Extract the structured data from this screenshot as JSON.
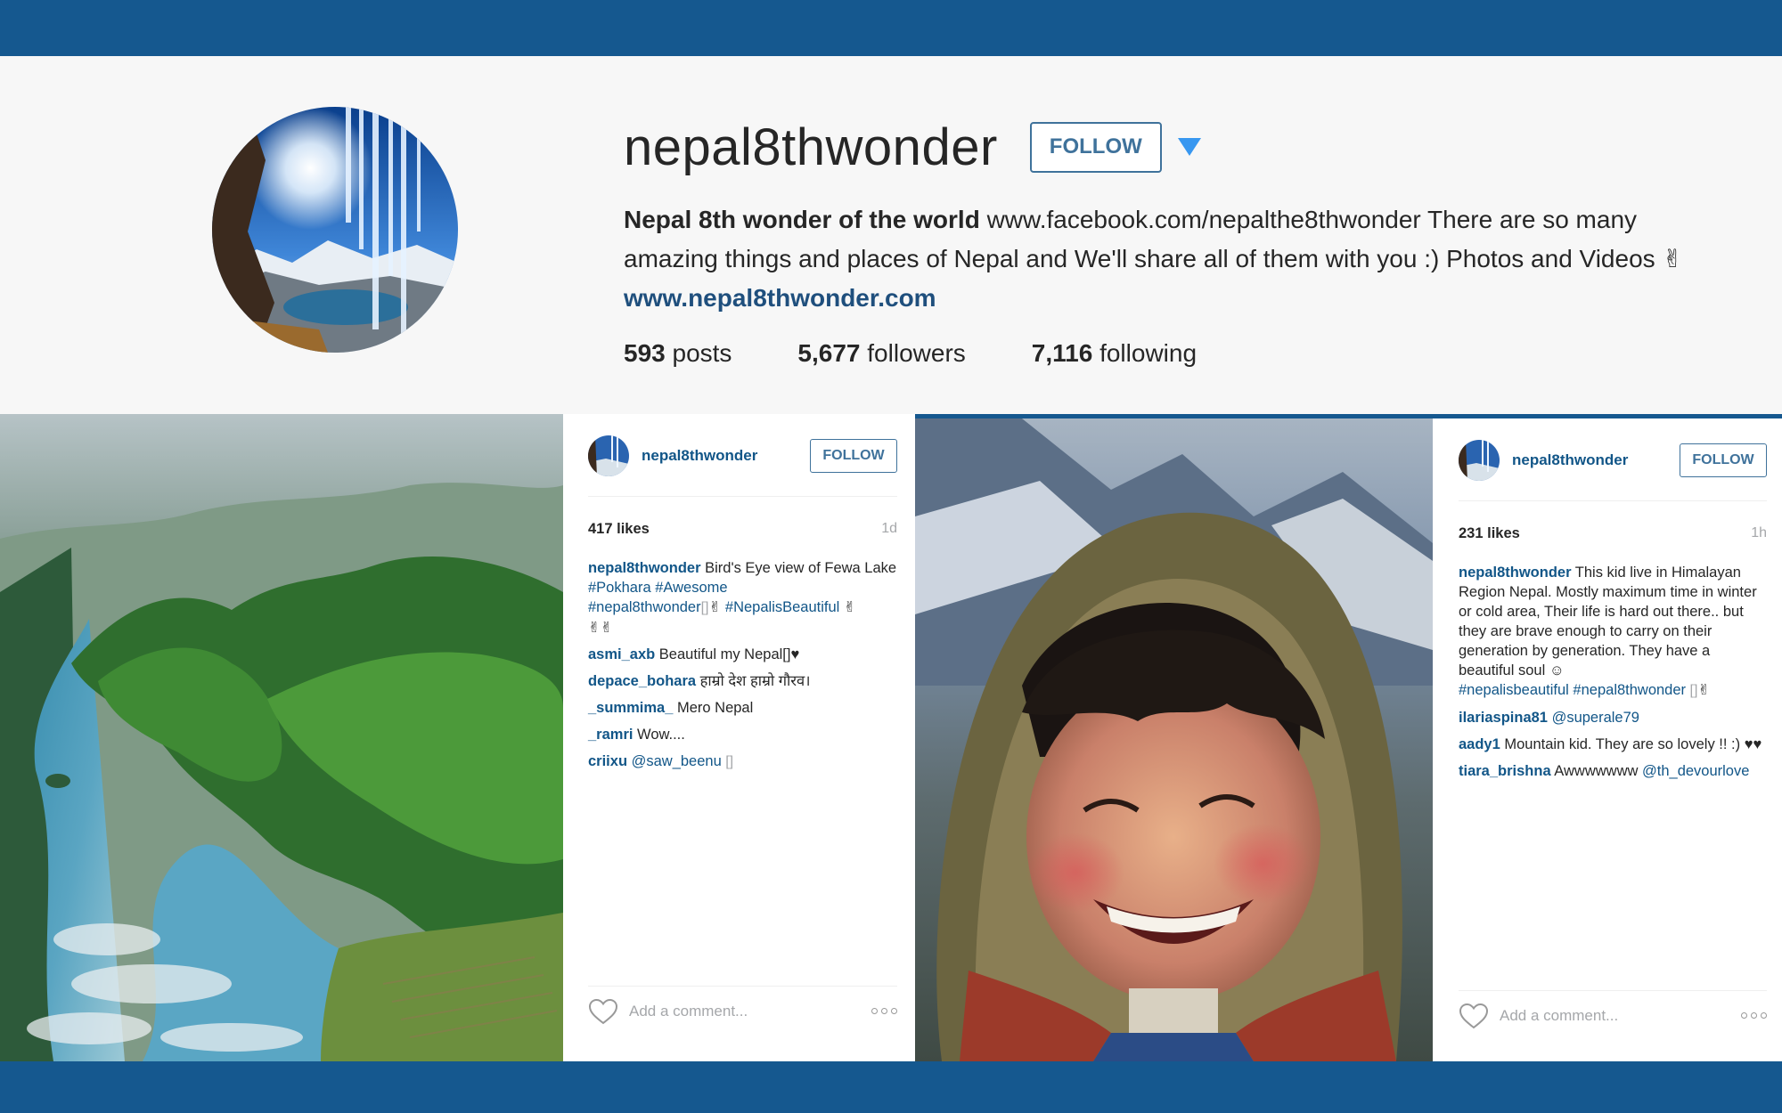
{
  "profile": {
    "username": "nepal8thwonder",
    "follow_label": "FOLLOW",
    "bio_name": "Nepal 8th wonder of the world",
    "bio_text_1": " www.facebook.com/nepalthe8thwonder There are so many amazing things and places of Nepal and We'll share all of them with you :) Photos and Videos ",
    "bio_emoji": "✌",
    "bio_link": "www.nepal8thwonder.com",
    "stats": {
      "posts_count": "593",
      "posts_label": " posts",
      "followers_count": "5,677",
      "followers_label": " followers",
      "following_count": "7,116",
      "following_label": " following"
    }
  },
  "post1": {
    "username": "nepal8thwonder",
    "follow_label": "FOLLOW",
    "likes": "417 likes",
    "time": "1d",
    "caption_user": "nepal8thwonder",
    "caption_text": " Bird's Eye view of Fewa Lake ",
    "caption_tag1": "#Pokhara",
    "caption_tag2": " #Awesome",
    "caption_tag3": "#nepal8thwonder",
    "caption_box": "[]",
    "caption_emoji1": "✌",
    "caption_tag4": " #NepalisBeautiful",
    "caption_emoji2": " ✌",
    "caption_emoji3": "✌✌",
    "comments": [
      {
        "user": "asmi_axb",
        "text": " Beautiful my Nepal[]♥"
      },
      {
        "user": "depace_bohara",
        "text": " हाम्रो देश हाम्रो गौरव।"
      },
      {
        "user": "_summima_",
        "text": " Mero Nepal"
      },
      {
        "user": "_ramri",
        "text": " Wow...."
      },
      {
        "user": "criixu",
        "tag": " @saw_beenu",
        "text": " []"
      }
    ],
    "comment_placeholder": "Add a comment..."
  },
  "post2": {
    "username": "nepal8thwonder",
    "follow_label": "FOLLOW",
    "likes": "231 likes",
    "time": "1h",
    "caption_user": "nepal8thwonder",
    "caption_text": " This kid live in Himalayan Region Nepal. Mostly maximum time in winter or cold area, Their life is hard out there.. but they are brave enough to carry on their generation by generation. They have a beautiful soul ☺",
    "caption_tags": "#nepalisbeautiful #nepal8thwonder",
    "caption_box": " []",
    "caption_emoji": "✌",
    "comments": [
      {
        "user": "ilariaspina81",
        "tag": " @superale79",
        "text": ""
      },
      {
        "user": "aady1",
        "tag": "",
        "text": " Mountain kid. They are so lovely !! :) ♥♥"
      },
      {
        "user": "tiara_brishna",
        "tag": "",
        "text": " Awwwwwww",
        "tag_after": " @th_devourlove"
      }
    ],
    "comment_placeholder": "Add a comment..."
  },
  "colors": {
    "band": "#15588f",
    "link": "#125688",
    "follow": "#3f729b"
  }
}
